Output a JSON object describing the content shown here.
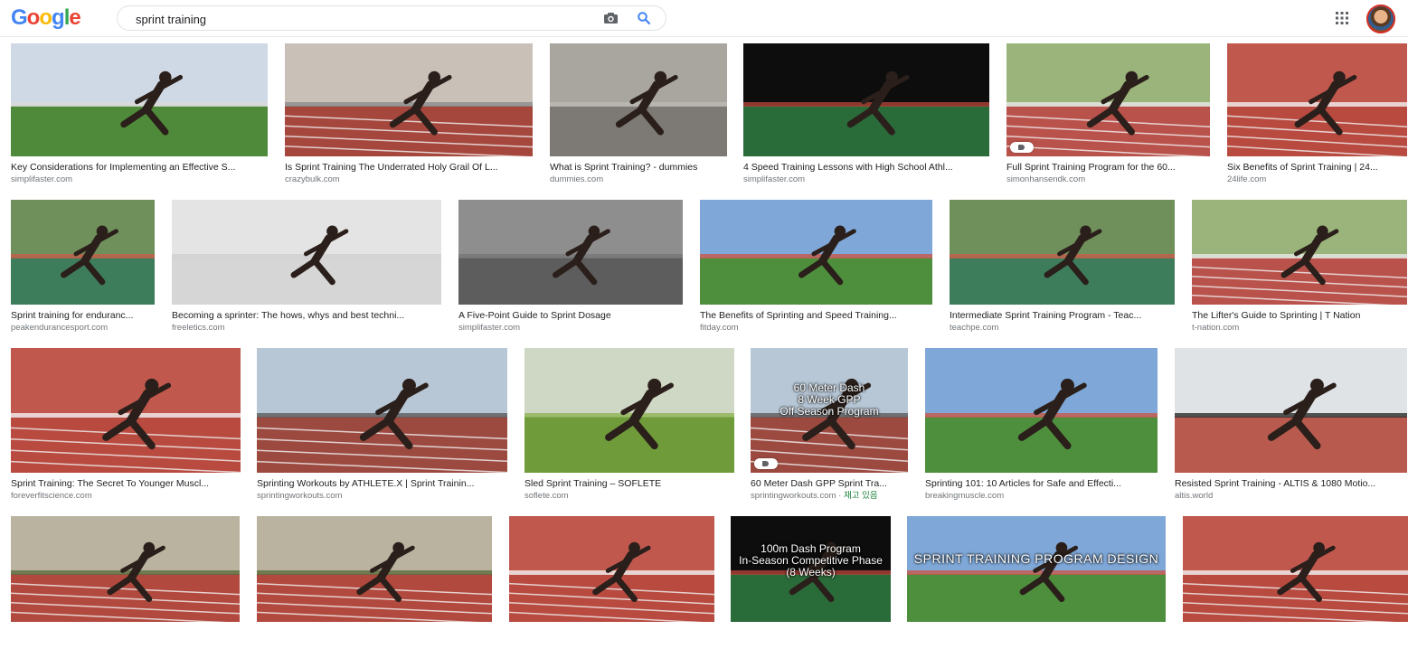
{
  "header": {
    "logo": [
      "G",
      "o",
      "o",
      "g",
      "l",
      "e"
    ],
    "search_value": "sprint training",
    "icons": [
      "camera-icon",
      "search-icon",
      "apps-grid-icon",
      "avatar"
    ]
  },
  "colors": {
    "link_gray": "#70757a",
    "google_blue": "#4285f4",
    "stock_green": "#188038"
  },
  "results": [
    {
      "caption": "Key Considerations for Implementing an Effective S...",
      "domain": "simplifaster.com",
      "scene": "field"
    },
    {
      "caption": "Is Sprint Training The Underrated Holy Grail Of L...",
      "domain": "crazybulk.com",
      "scene": "brick"
    },
    {
      "caption": "What is Sprint Training? - dummies",
      "domain": "dummies.com",
      "scene": "concrete"
    },
    {
      "caption": "4 Speed Training Lessons with High School Athl...",
      "domain": "simplifaster.com",
      "scene": "dark"
    },
    {
      "caption": "Full Sprint Training Program for the 60...",
      "domain": "simonhansendk.com",
      "scene": "track"
    },
    {
      "caption": "Six Benefits of Sprint Training | 24...",
      "domain": "24life.com",
      "scene": "tracklines"
    },
    {
      "caption": "Sprint training for enduranc...",
      "domain": "peakendurancesport.com",
      "scene": "race"
    },
    {
      "caption": "Becoming a sprinter: The hows, whys and best techni...",
      "domain": "freeletics.com",
      "scene": "studio"
    },
    {
      "caption": "A Five-Point Guide to Sprint Dosage",
      "domain": "simplifaster.com",
      "scene": "shadow"
    },
    {
      "caption": "The Benefits of Sprinting and Speed Training...",
      "domain": "fitday.com",
      "scene": "sky"
    },
    {
      "caption": "Intermediate Sprint Training Program - Teac...",
      "domain": "teachpe.com",
      "scene": "race"
    },
    {
      "caption": "The Lifter's Guide to Sprinting | T Nation",
      "domain": "t-nation.com",
      "scene": "track"
    },
    {
      "caption": "Sprint Training: The Secret To Younger Muscl...",
      "domain": "foreverfitscience.com",
      "scene": "tracklines"
    },
    {
      "caption": "Sprinting Workouts by ATHLETE.X | Sprint Trainin...",
      "domain": "sprintingworkouts.com",
      "scene": "fence"
    },
    {
      "caption": "Sled Sprint Training – SOFLETE",
      "domain": "soflete.com",
      "scene": "grass"
    },
    {
      "caption": "60 Meter Dash GPP Sprint Tra...",
      "domain": "sprintingworkouts.com",
      "stock": "재고 있음",
      "scene": "fence",
      "overlay": [
        "60 Meter Dash",
        "8 Week GPP",
        "Off Season Program"
      ]
    },
    {
      "caption": "Sprinting 101: 10 Articles for Safe and Effecti...",
      "domain": "breakingmuscle.com",
      "scene": "sky"
    },
    {
      "caption": "Resisted Sprint Training - ALTIS & 1080 Motio...",
      "domain": "altis.world",
      "scene": "tent"
    },
    {
      "scene": "trees"
    },
    {
      "scene": "trees"
    },
    {
      "scene": "tracklines"
    },
    {
      "scene": "dark",
      "overlay": [
        "100m Dash Program",
        "In-Season Competitive Phase",
        "(8 Weeks)"
      ]
    },
    {
      "scene": "sky",
      "overlay": [
        "SPRINT TRAINING PROGRAM DESIGN"
      ],
      "overlay_big": true
    },
    {
      "scene": "tracklines"
    }
  ]
}
